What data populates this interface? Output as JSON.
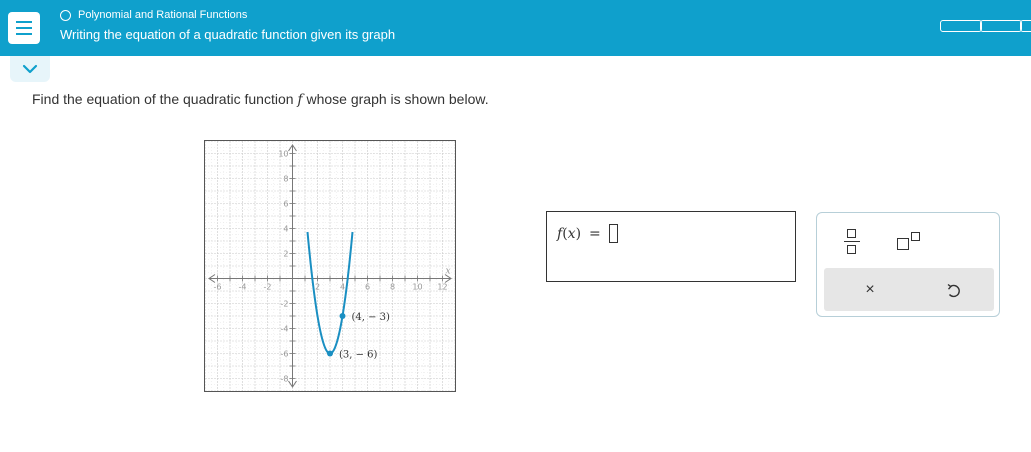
{
  "header": {
    "breadcrumb": "Polynomial and Rational Functions",
    "title": "Writing the equation of a quadratic function given its graph",
    "progress_segments": 3,
    "accent_color": "#0fa0cc"
  },
  "question": {
    "prompt_before": "Find the equation of the quadratic function",
    "prompt_var": "f",
    "prompt_after": "whose graph is shown below."
  },
  "chart_data": {
    "type": "line",
    "xlim": [
      -7,
      13
    ],
    "ylim": [
      -9,
      11
    ],
    "grid": true,
    "xlabel": "x",
    "ylabel": "",
    "x_ticks": [
      -6,
      -4,
      -2,
      2,
      4,
      6,
      8,
      10,
      12
    ],
    "y_ticks": [
      10,
      8,
      6,
      4,
      2,
      -2,
      -4,
      -6,
      -8
    ],
    "tick_labels_x": [
      "-6",
      "-4",
      "-2",
      "2",
      "4",
      "6",
      "8",
      "10",
      "12"
    ],
    "tick_labels_y": [
      "10",
      "8",
      "6",
      "4",
      "2",
      "-2",
      "-4",
      "-6",
      "-8"
    ],
    "series": [
      {
        "function": "3(x-3)^2 - 6",
        "x_range": [
          1.2,
          4.8
        ],
        "color": "#1a8fc2"
      }
    ],
    "points": [
      {
        "x": 4,
        "y": -3,
        "label": "(4, − 3)"
      },
      {
        "x": 3,
        "y": -6,
        "label": "(3, − 6)"
      }
    ]
  },
  "answer": {
    "func_name": "f",
    "func_arg": "x",
    "equals": "="
  },
  "toolbox": {
    "clear_symbol": "×"
  }
}
